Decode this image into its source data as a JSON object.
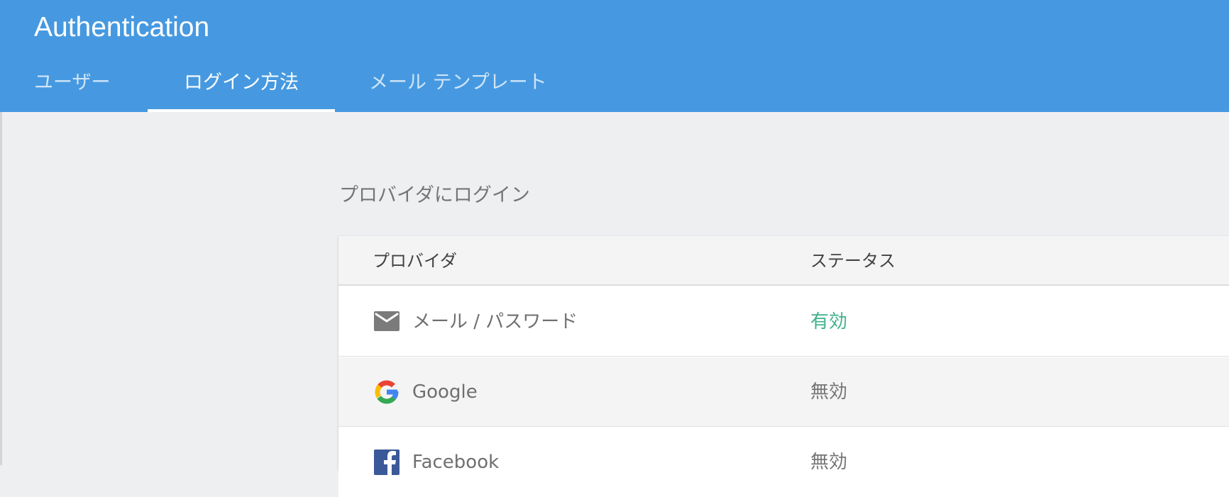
{
  "header": {
    "title": "Authentication",
    "tabs": [
      {
        "label": "ユーザー",
        "active": false
      },
      {
        "label": "ログイン方法",
        "active": true
      },
      {
        "label": "メール テンプレート",
        "active": false
      }
    ]
  },
  "main": {
    "section_title": "プロバイダにログイン",
    "table": {
      "columns": [
        "プロバイダ",
        "ステータス"
      ],
      "rows": [
        {
          "icon": "mail-icon",
          "provider": "メール / パスワード",
          "status": "有効",
          "status_color": "#3fb08c"
        },
        {
          "icon": "google-icon",
          "provider": "Google",
          "status": "無効",
          "status_color": "#757575"
        },
        {
          "icon": "facebook-icon",
          "provider": "Facebook",
          "status": "無効",
          "status_color": "#757575"
        }
      ]
    }
  },
  "colors": {
    "header_bg": "#4699e0",
    "page_bg": "#eeeff1",
    "enabled": "#3fb08c"
  }
}
